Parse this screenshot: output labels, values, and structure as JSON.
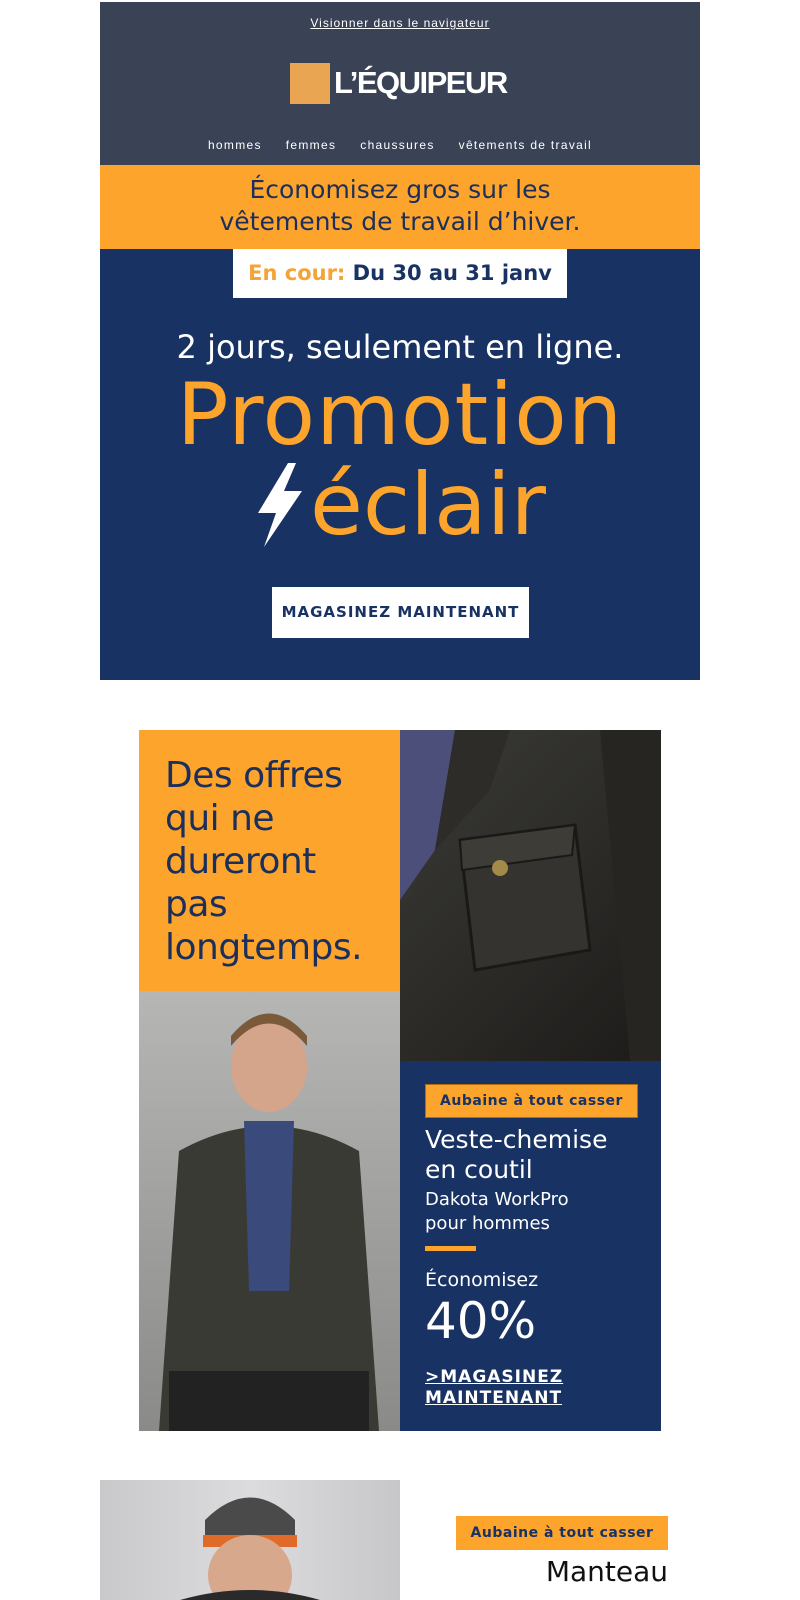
{
  "header": {
    "view_in_browser": "Visionner dans le navigateur",
    "logo_text": "L’ÉQUIPEUR",
    "nav": [
      "hommes",
      "femmes",
      "chaussures",
      "vêtements de travail"
    ]
  },
  "band": {
    "line1": "Économisez gros sur les",
    "line2": "vêtements de travail d’hiver."
  },
  "hero": {
    "date_label": "En cour:",
    "date_range": "Du 30 au 31 janv",
    "subhead": "2 jours, seulement en ligne.",
    "title_line1": "Promotion",
    "title_line2": "éclair",
    "cta": "MAGASINEZ MAINTENANT"
  },
  "offers": {
    "line1": "Des offres",
    "line2": "qui ne",
    "line3": "dureront",
    "line4": "pas",
    "line5": "longtemps."
  },
  "deal1": {
    "badge": "Aubaine à tout casser",
    "title_line1": "Veste-chemise",
    "title_line2": "en coutil",
    "sub_line1": "Dakota WorkPro",
    "sub_line2": "pour hommes",
    "save_label": "Économisez",
    "save_value": "40%",
    "link_line1": ">MAGASINEZ",
    "link_line2": "MAINTENANT"
  },
  "deal2": {
    "badge": "Aubaine à tout casser",
    "title_line1": "Manteau"
  },
  "colors": {
    "navy": "#173263",
    "orange": "#fca42b",
    "header_slate": "#3a4256",
    "white": "#ffffff"
  }
}
